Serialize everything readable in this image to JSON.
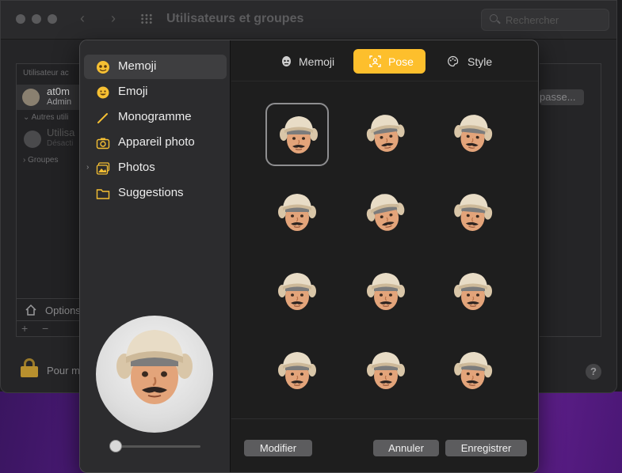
{
  "window": {
    "title": "Utilisateurs et groupes",
    "search_placeholder": "Rechercher"
  },
  "background_window": {
    "current_users_header": "Utilisateur ac",
    "user_name": "at0m",
    "user_role": "Admin",
    "other_users_header": "Autres utili",
    "other_user_name": "Utilisa",
    "other_user_status": "Désacti",
    "groups_label": "Groupes",
    "options_label": "Options",
    "plus": "+",
    "minus": "−",
    "password_button": "passe...",
    "lock_text": "Pour m",
    "help": "?"
  },
  "sidebar": {
    "items": [
      {
        "label": "Memoji",
        "icon": "memoji-icon",
        "active": true
      },
      {
        "label": "Emoji",
        "icon": "emoji-icon",
        "active": false
      },
      {
        "label": "Monogramme",
        "icon": "pencil-icon",
        "active": false
      },
      {
        "label": "Appareil photo",
        "icon": "camera-icon",
        "active": false
      },
      {
        "label": "Photos",
        "icon": "photos-icon",
        "active": false,
        "expandable": true
      },
      {
        "label": "Suggestions",
        "icon": "folder-icon",
        "active": false
      }
    ],
    "size_slider_value": 0
  },
  "segments": [
    {
      "label": "Memoji",
      "icon": "memoji-head-icon",
      "active": false
    },
    {
      "label": "Pose",
      "icon": "pose-icon",
      "active": true
    },
    {
      "label": "Style",
      "icon": "palette-icon",
      "active": false
    }
  ],
  "poses": {
    "selected_index": 0,
    "count": 12
  },
  "footer": {
    "modify_label": "Modifier",
    "cancel_label": "Annuler",
    "save_label": "Enregistrer"
  },
  "colors": {
    "accent": "#fdbf2c",
    "skin": "#e3a47a",
    "hat": "#e2d2b8",
    "hair": "#7c7c7c"
  }
}
